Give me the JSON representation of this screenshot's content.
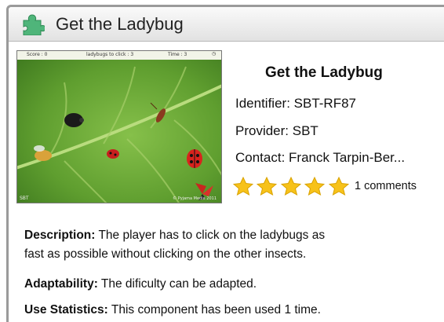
{
  "header": {
    "title": "Get the Ladybug",
    "icon": "puzzle-piece-icon"
  },
  "thumbnail": {
    "hud": {
      "score": "Score : 0",
      "ladybugs": "ladybugs to click : 3",
      "time": "Time : 3",
      "timer_symbol": "◷"
    },
    "footer_left": "SBT",
    "footer_right": "© Pyjama Media 2011"
  },
  "info": {
    "name": "Get the Ladybug",
    "identifier": "Identifier: SBT-RF87",
    "provider": "Provider: SBT",
    "contact": "Contact: Franck Tarpin-Ber...",
    "rating_stars": 5,
    "comments": "1 comments"
  },
  "description": {
    "label": "Description:",
    "text": " The player has to click on the ladybugs as",
    "text2": "fast as possible without clicking on the other insects."
  },
  "adaptability": {
    "label": "Adaptability:",
    "text": " The dificulty can be adapted."
  },
  "statistics": {
    "label": "Use Statistics:",
    "text": " This component has been used 1 time."
  },
  "colors": {
    "star": "#f7c21a",
    "leaf": "#5f9e2f",
    "titlebar": "#e6e6e6"
  }
}
